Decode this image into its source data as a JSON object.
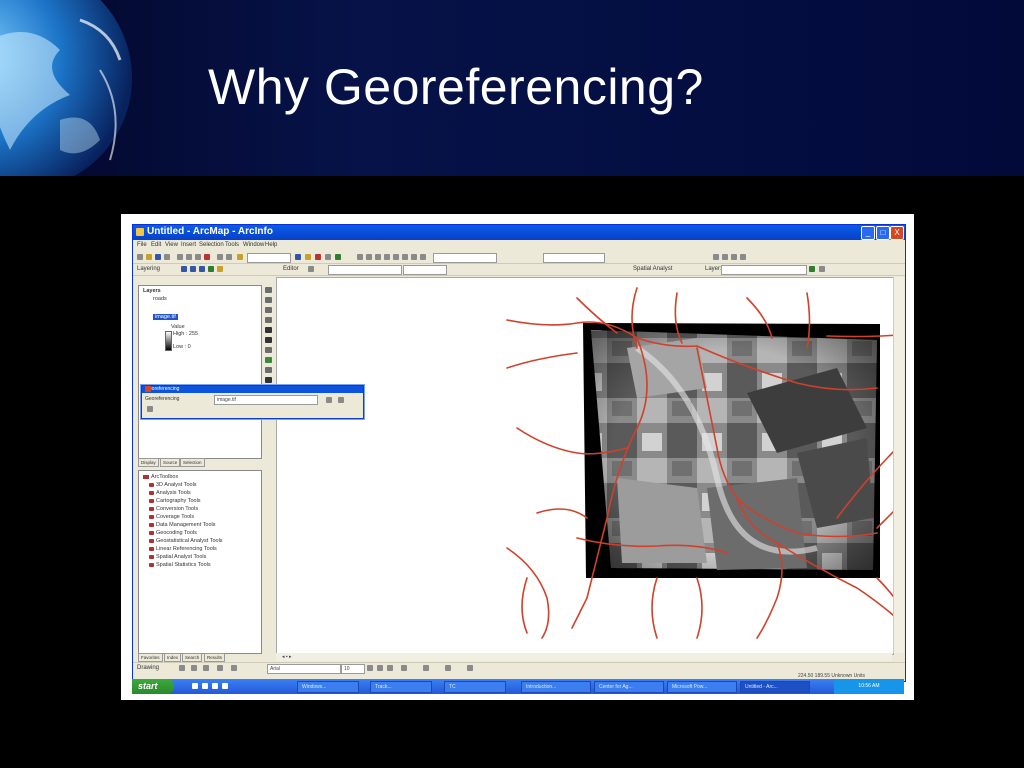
{
  "slide": {
    "title": "Why Georeferencing?"
  },
  "window": {
    "title": "Untitled - ArcMap - ArcInfo",
    "controls": [
      "_",
      "□",
      "X"
    ]
  },
  "menu": [
    "File",
    "Edit",
    "View",
    "Insert",
    "Selection",
    "Tools",
    "Window",
    "Help"
  ],
  "toolbars": {
    "scale_value": "",
    "layout_label": "Layering",
    "editor_label": "Editor",
    "spatial_analyst_label": "Spatial Analyst",
    "layer_label": "Layer:"
  },
  "toc": {
    "layers_label": "Layers",
    "items": [
      "roads",
      "image.tif"
    ],
    "legend_title": "Value",
    "legend_high": "High : 255",
    "legend_low": "Low : 0",
    "tabs": [
      "Display",
      "Source",
      "Selection"
    ]
  },
  "georef_dialog": {
    "title": "Georeferencing",
    "menu_label": "Georeferencing",
    "layer_value": "image.tif"
  },
  "toolbox": {
    "root": "ArcToolbox",
    "tools": [
      "3D Analyst Tools",
      "Analysis Tools",
      "Cartography Tools",
      "Conversion Tools",
      "Coverage Tools",
      "Data Management Tools",
      "Geocoding Tools",
      "Geostatistical Analyst Tools",
      "Linear Referencing Tools",
      "Spatial Analyst Tools",
      "Spatial Statistics Tools"
    ],
    "tabs": [
      "Favorites",
      "Index",
      "Search",
      "Results"
    ]
  },
  "drawing": {
    "label": "Drawing",
    "font": "Arial",
    "size": "10"
  },
  "status": {
    "coords": "224.50  189.55  Unknown Units"
  },
  "taskbar": {
    "start_label": "start",
    "tasks": [
      "Windows...",
      "Track...",
      "TC",
      "Introduction...",
      "Center for Ag...",
      "Microsoft Pow...",
      "Untitled - Arc..."
    ],
    "clock": "10:56 AM"
  },
  "colors": {
    "road": "#d0402a",
    "title_bar": "#0a5de8",
    "header_bg": "#061248"
  }
}
